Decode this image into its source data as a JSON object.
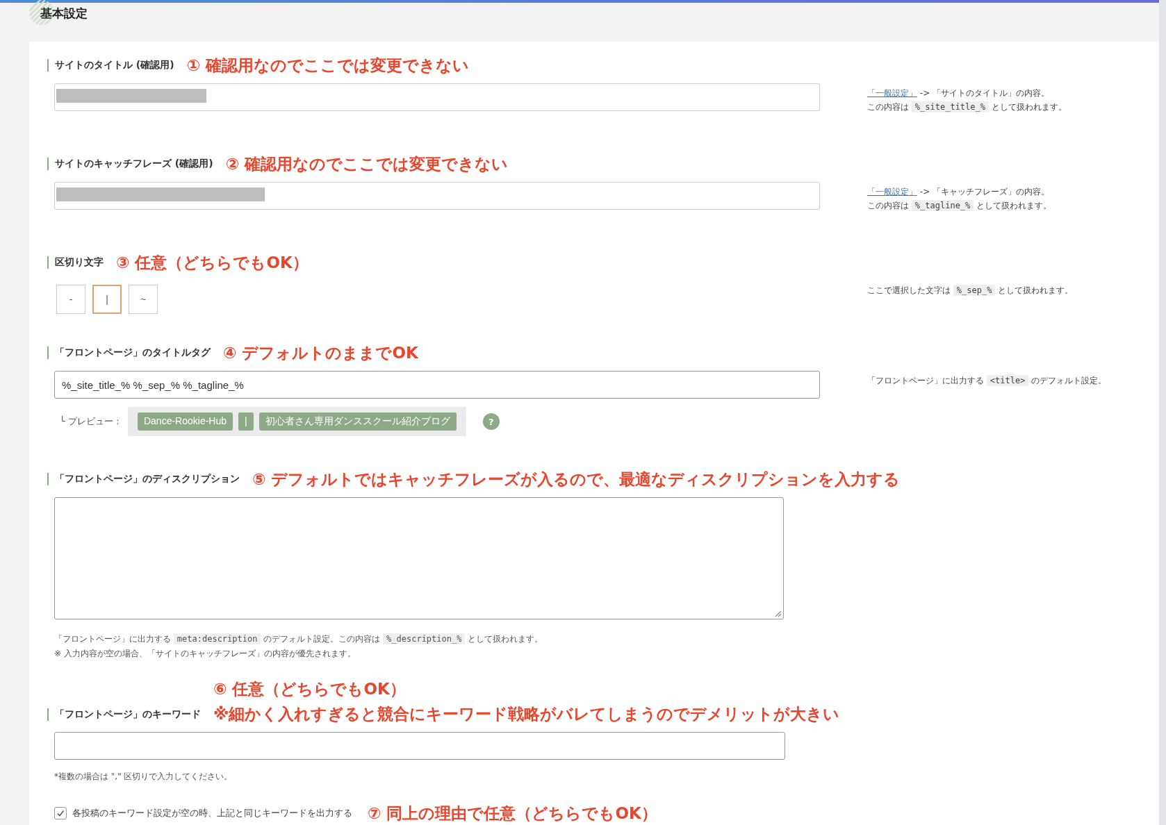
{
  "page_title": "基本設定",
  "sections": [
    {
      "kind": "redacted",
      "label": "サイトのタイトル (確認用)",
      "annotation": [
        "① 確認用なのでここでは変更できない"
      ],
      "notes": [
        [
          {
            "kind": "link",
            "text": "「一般設定」"
          },
          {
            "kind": "text",
            "text": " -> 「サイトのタイトル」の内容。"
          }
        ],
        [
          {
            "kind": "text",
            "text": "この内容は "
          },
          {
            "kind": "code",
            "text": "%_site_title_%"
          },
          {
            "kind": "text",
            "text": " として扱われます。"
          }
        ]
      ]
    },
    {
      "kind": "redacted",
      "label": "サイトのキャッチフレーズ (確認用)",
      "annotation": [
        "② 確認用なのでここでは変更できない"
      ],
      "notes": [
        [
          {
            "kind": "link",
            "text": "「一般設定」"
          },
          {
            "kind": "text",
            "text": " -> 「キャッチフレーズ」の内容。"
          }
        ],
        [
          {
            "kind": "text",
            "text": "この内容は "
          },
          {
            "kind": "code",
            "text": "%_tagline_%"
          },
          {
            "kind": "text",
            "text": " として扱われます。"
          }
        ]
      ]
    },
    {
      "kind": "separator",
      "label": "区切り文字",
      "annotation": [
        "③ 任意（どちらでもOK）"
      ],
      "options": [
        {
          "label": "-",
          "selected": false
        },
        {
          "label": "|",
          "selected": true
        },
        {
          "label": "~",
          "selected": false
        }
      ],
      "notes": [
        [
          {
            "kind": "text",
            "text": "ここで選択した文字は "
          },
          {
            "kind": "code",
            "text": "%_sep_%"
          },
          {
            "kind": "text",
            "text": " として扱われます。"
          }
        ]
      ]
    },
    {
      "kind": "text",
      "label": "「フロントページ」のタイトルタグ",
      "annotation": [
        "④ デフォルトのままでOK"
      ],
      "value": "%_site_title_% %_sep_% %_tagline_%",
      "preview": {
        "label": "└ プレビュー：",
        "chips": [
          "Dance-Rookie-Hub",
          "|",
          "初心者さん専用ダンススクール紹介ブログ"
        ],
        "help": "?"
      },
      "notes": [
        [
          {
            "kind": "text",
            "text": "「フロントページ」に出力する "
          },
          {
            "kind": "code",
            "text": "<title>"
          },
          {
            "kind": "text",
            "text": " のデフォルト設定。"
          }
        ]
      ]
    },
    {
      "kind": "textarea",
      "label": "「フロントページ」のディスクリプション",
      "annotation": [
        "⑤ デフォルトではキャッチフレーズが入るので、最適なディスクリプションを入力する"
      ],
      "hints": [
        [
          {
            "kind": "text",
            "text": "「フロントページ」に出力する "
          },
          {
            "kind": "code",
            "text": "meta:description"
          },
          {
            "kind": "text",
            "text": " のデフォルト設定。この内容は "
          },
          {
            "kind": "code",
            "text": "%_description_%"
          },
          {
            "kind": "text",
            "text": " として扱われます。"
          }
        ],
        [
          {
            "kind": "text",
            "text": "※ 入力内容が空の場合、「サイトのキャッチフレーズ」の内容が優先されます。"
          }
        ]
      ]
    },
    {
      "kind": "keywords",
      "label": "「フロントページ」のキーワード",
      "annotation": [
        "⑥ 任意（どちらでもOK）",
        "※細かく入れすぎると競合にキーワード戦略がバレてしまうのでデメリットが大きい"
      ],
      "hints": [
        [
          {
            "kind": "text",
            "text": "*複数の場合は \",\" 区切りで入力してください。"
          }
        ]
      ],
      "checkbox": {
        "label": "各投稿のキーワード設定が空の時、上記と同じキーワードを出力する",
        "checked": true,
        "annotation": "⑦ 同上の理由で任意（どちらでもOK）"
      }
    }
  ]
}
